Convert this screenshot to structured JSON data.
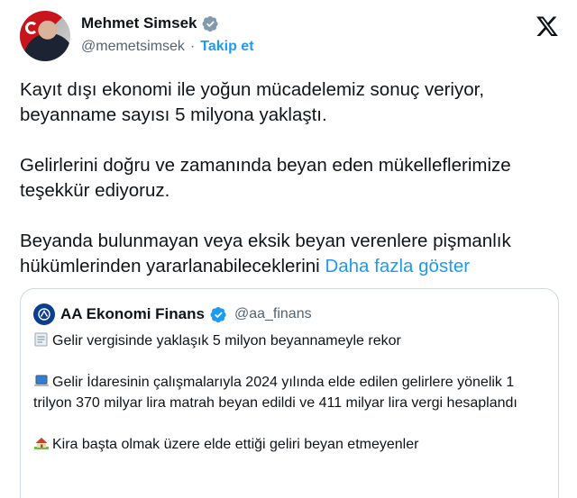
{
  "author": {
    "name": "Mehmet Simsek",
    "handle": "@memetsimsek",
    "separator": "·",
    "follow_label": "Takip et"
  },
  "tweet": {
    "paragraphs": [
      "Kayıt dışı ekonomi ile yoğun mücadelemiz sonuç veriyor, beyanname sayısı 5 milyona yaklaştı.",
      "Gelirlerini doğru ve zamanında beyan eden mükelleflerimize teşekkür ediyoruz."
    ],
    "last_paragraph": "Beyanda bulunmayan veya eksik beyan verenlere pişmanlık hükümlerinden yararlanabileceklerini",
    "show_more": "Daha fazla göster"
  },
  "quote": {
    "name": "AA Ekonomi Finans",
    "handle": "@aa_finans",
    "lines": [
      {
        "icon": "receipt-icon",
        "text": "Gelir vergisinde yaklaşık 5 milyon beyannameyle rekor"
      },
      {
        "icon": "laptop-icon",
        "text": "Gelir İdaresinin çalışmalarıyla 2024 yılında elde edilen gelirlere yönelik 1 trilyon 370 milyar lira matrah beyan edildi ve 411 milyar lira vergi hesaplandı"
      },
      {
        "icon": "house-icon",
        "text": "Kira başta olmak üzere elde ettiği geliri beyan etmeyenler"
      }
    ]
  },
  "colors": {
    "accent": "#1d9bf0",
    "text": "#0f1419",
    "muted": "#536471",
    "border": "#cfd9de"
  }
}
